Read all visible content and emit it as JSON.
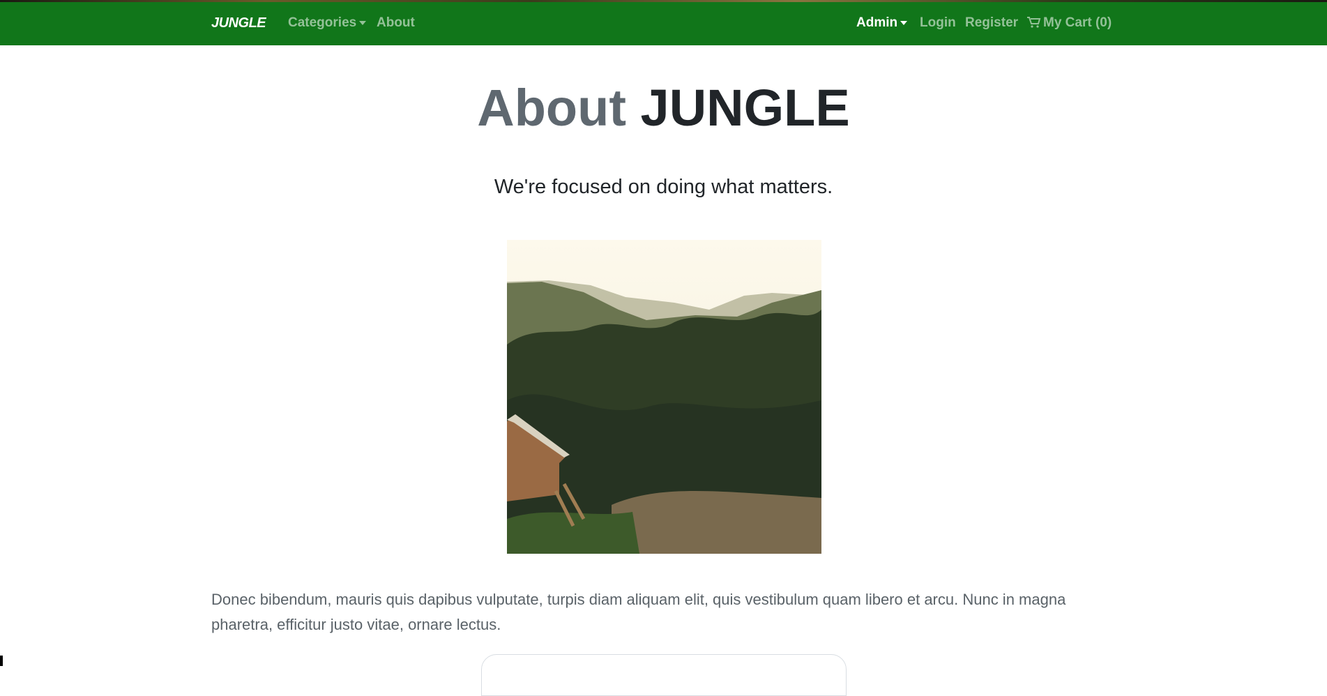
{
  "nav": {
    "brand": "JUNGLE",
    "categories": "Categories",
    "about": "About",
    "admin": "Admin",
    "login": "Login",
    "register": "Register",
    "cart": "My Cart (0)"
  },
  "hero": {
    "title_light": "About",
    "title_bold": "JUNGLE",
    "subtitle": "We're focused on doing what matters."
  },
  "body": {
    "paragraph": "Donec bibendum, mauris quis dapibus vulputate, turpis diam aliquam elit, quis vestibulum quam libero et arcu. Nunc in magna pharetra, efficitur justo vitae, ornare lectus."
  },
  "colors": {
    "navbar": "#11761a"
  }
}
